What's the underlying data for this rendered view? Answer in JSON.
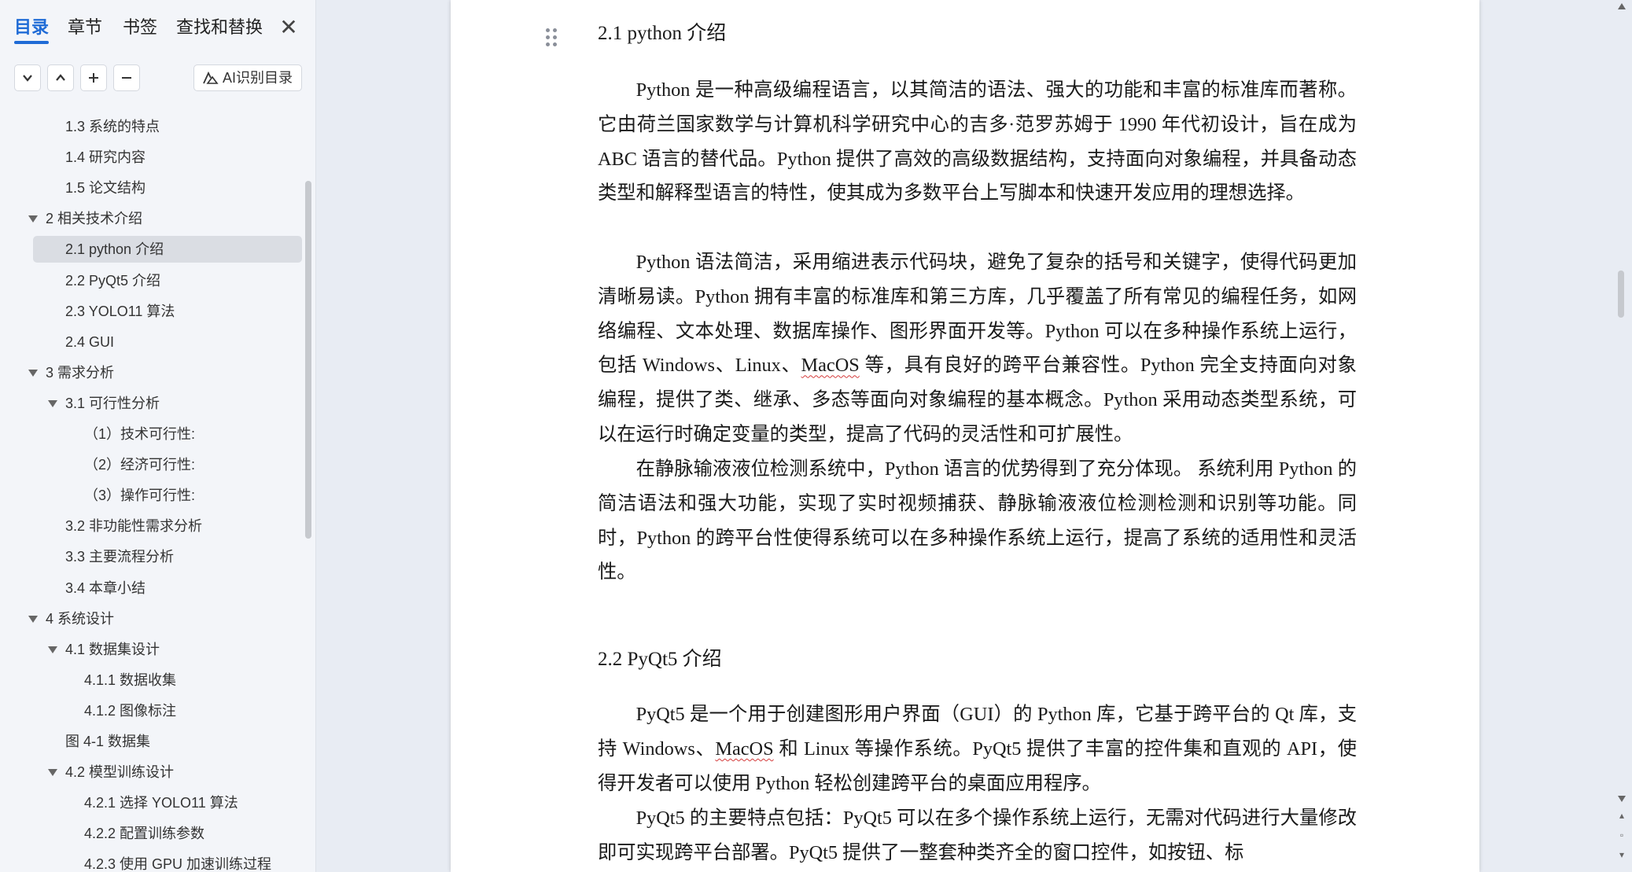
{
  "nav": {
    "tabs": [
      "目录",
      "章节",
      "书签",
      "查找和替换"
    ],
    "close_label": "✕",
    "toolbar": {
      "ai_button": "AI识别目录"
    },
    "toc": [
      {
        "label": "1.3 系统的特点",
        "level": 2
      },
      {
        "label": "1.4 研究内容",
        "level": 2
      },
      {
        "label": "1.5 论文结构",
        "level": 2
      },
      {
        "label": "2  相关技术介绍",
        "level": 1,
        "expanded": true
      },
      {
        "label": "2.1 python 介绍",
        "level": 2,
        "selected": true
      },
      {
        "label": "2.2 PyQt5 介绍",
        "level": 2
      },
      {
        "label": "2.3 YOLO11 算法",
        "level": 2
      },
      {
        "label": "2.4 GUI",
        "level": 2
      },
      {
        "label": "3  需求分析",
        "level": 1,
        "expanded": true
      },
      {
        "label": "3.1 可行性分析",
        "level": 2,
        "expanded": true
      },
      {
        "label": "（1）技术可行性:",
        "level": 3
      },
      {
        "label": "（2）经济可行性:",
        "level": 3
      },
      {
        "label": "（3）操作可行性:",
        "level": 3
      },
      {
        "label": "3.2  非功能性需求分析",
        "level": 2
      },
      {
        "label": "3.3 主要流程分析",
        "level": 2
      },
      {
        "label": "3.4 本章小结",
        "level": 2
      },
      {
        "label": "4  系统设计",
        "level": 1,
        "expanded": true
      },
      {
        "label": "4.1  数据集设计",
        "level": 2,
        "expanded": true
      },
      {
        "label": "4.1.1 数据收集",
        "level": 3
      },
      {
        "label": "4.1.2 图像标注",
        "level": 3
      },
      {
        "label": "图 4-1  数据集",
        "level": 2
      },
      {
        "label": "4.2  模型训练设计",
        "level": 2,
        "expanded": true
      },
      {
        "label": "4.2.1  选择  YOLO11  算法",
        "level": 3
      },
      {
        "label": "4.2.2  配置训练参数",
        "level": 3
      },
      {
        "label": "4.2.3  使用  GPU  加速训练过程",
        "level": 3
      }
    ]
  },
  "document": {
    "heading1": "2.1 python 介绍",
    "p1": "Python 是一种高级编程语言，以其简洁的语法、强大的功能和丰富的标准库而著称。它由荷兰国家数学与计算机科学研究中心的吉多·范罗苏姆于 1990 年代初设计，旨在成为 ABC 语言的替代品。Python 提供了高效的高级数据结构，支持面向对象编程，并具备动态类型和解释型语言的特性，使其成为多数平台上写脚本和快速开发应用的理想选择。",
    "p2a": "Python 语法简洁，采用缩进表示代码块，避免了复杂的括号和关键字，使得代码更加清晰易读。Python 拥有丰富的标准库和第三方库，几乎覆盖了所有常见的编程任务，如网络编程、文本处理、数据库操作、图形界面开发等。Python 可以在多种操作系统上运行，包括 Windows、Linux、",
    "p2_macos": "MacOS",
    "p2b": " 等，具有良好的跨平台兼容性。Python 完全支持面向对象编程，提供了类、继承、多态等面向对象编程的基本概念。Python 采用动态类型系统，可以在运行时确定变量的类型，提高了代码的灵活性和可扩展性。",
    "p3": "在静脉输液液位检测系统中，Python 语言的优势得到了充分体现。 系统利用 Python 的简洁语法和强大功能，实现了实时视频捕获、静脉输液液位检测检测和识别等功能。同时，Python 的跨平台性使得系统可以在多种操作系统上运行，提高了系统的适用性和灵活性。",
    "heading2": "2.2 PyQt5 介绍",
    "p4a": "PyQt5 是一个用于创建图形用户界面（GUI）的 Python 库，它基于跨平台的 Qt 库，支持 Windows、",
    "p4_macos": "MacOS",
    "p4b": " 和 Linux 等操作系统。PyQt5 提供了丰富的控件集和直观的 API，使得开发者可以使用 Python 轻松创建跨平台的桌面应用程序。",
    "p5": "PyQt5 的主要特点包括：PyQt5 可以在多个操作系统上运行，无需对代码进行大量修改即可实现跨平台部署。PyQt5 提供了一整套种类齐全的窗口控件，如按钮、标"
  }
}
